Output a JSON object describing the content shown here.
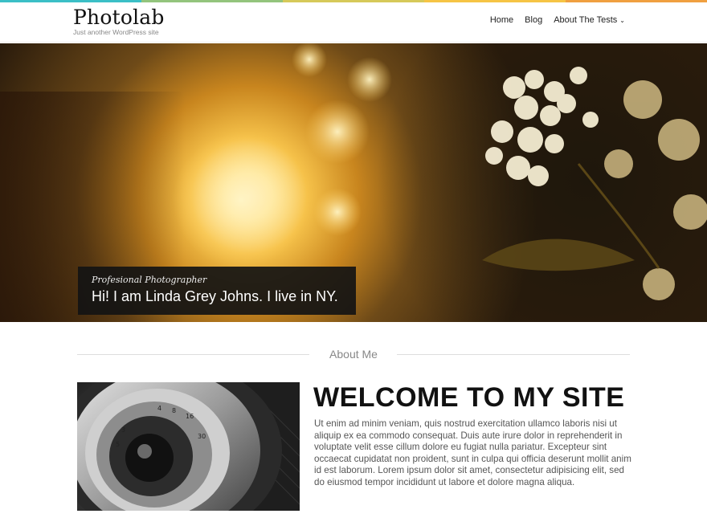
{
  "site": {
    "title": "Photolab",
    "tagline": "Just another WordPress site"
  },
  "top_bar_colors": [
    "#3bbfc6",
    "#93c47d",
    "#d6c95a",
    "#f6c445",
    "#f0a040"
  ],
  "nav": {
    "items": [
      {
        "label": "Home"
      },
      {
        "label": "Blog"
      },
      {
        "label": "About The Tests",
        "has_dropdown": true,
        "chevron_icon": "chevron-down-icon"
      }
    ]
  },
  "hero": {
    "subtitle": "Profesional Photographer",
    "title": "Hi! I am Linda Grey Johns. I live in NY."
  },
  "about": {
    "section_title": "About Me",
    "heading": "WELCOME TO MY SITE",
    "body": "Ut enim ad minim veniam, quis nostrud exercitation ullamco laboris nisi ut aliquip ex ea commodo consequat. Duis aute irure dolor in reprehenderit in voluptate velit esse cillum dolore eu fugiat nulla pariatur. Excepteur sint occaecat cupidatat non proident, sunt in culpa qui officia deserunt mollit anim id est laborum. Lorem ipsum dolor sit amet, consectetur adipisicing elit, sed do eiusmod tempor incididunt ut labore et dolore magna aliqua."
  }
}
